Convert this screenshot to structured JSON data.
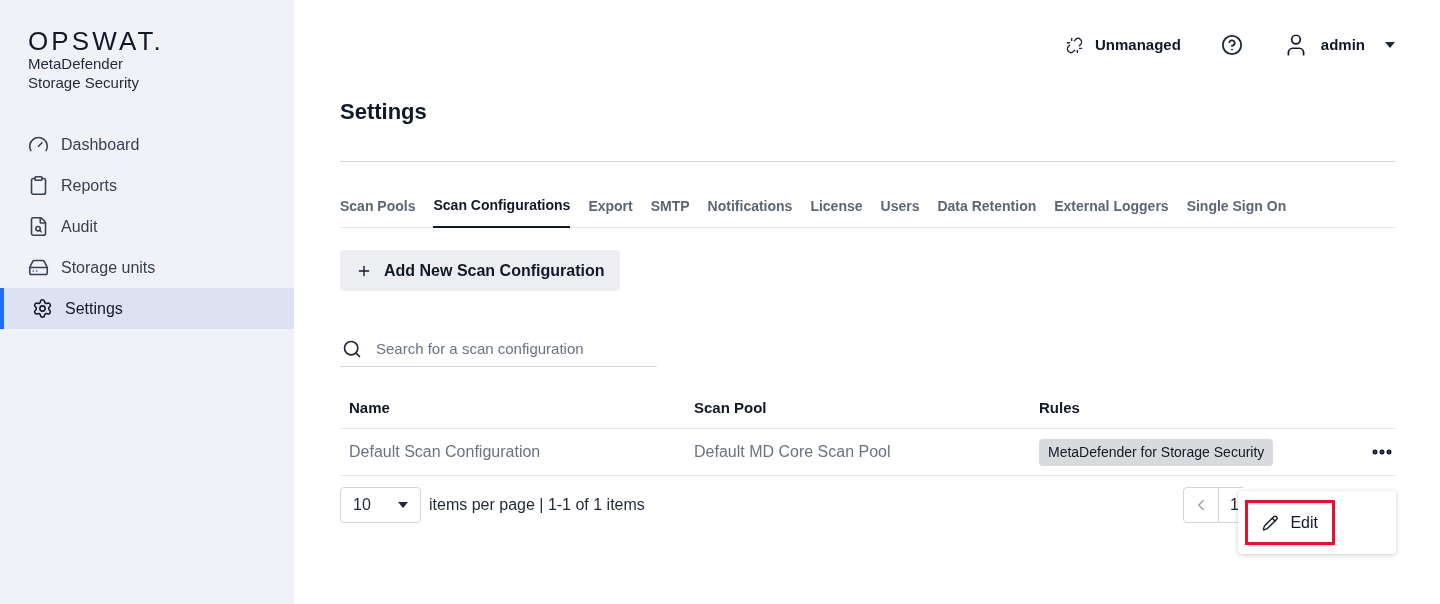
{
  "brand": {
    "logo": "OPSWAT.",
    "product": [
      "MetaDefender",
      "Storage Security"
    ]
  },
  "sidebar": {
    "items": [
      {
        "label": "Dashboard",
        "selected": false
      },
      {
        "label": "Reports",
        "selected": false
      },
      {
        "label": "Audit",
        "selected": false
      },
      {
        "label": "Storage units",
        "selected": false
      },
      {
        "label": "Settings",
        "selected": true
      }
    ]
  },
  "header": {
    "status": "Unmanaged",
    "user": "admin"
  },
  "page_title": "Settings",
  "tabs": [
    {
      "label": "Scan Pools",
      "selected": false
    },
    {
      "label": "Scan Configurations",
      "selected": true
    },
    {
      "label": "Export",
      "selected": false
    },
    {
      "label": "SMTP",
      "selected": false
    },
    {
      "label": "Notifications",
      "selected": false
    },
    {
      "label": "License",
      "selected": false
    },
    {
      "label": "Users",
      "selected": false
    },
    {
      "label": "Data Retention",
      "selected": false
    },
    {
      "label": "External Loggers",
      "selected": false
    },
    {
      "label": "Single Sign On",
      "selected": false
    }
  ],
  "add_button": "Add New Scan Configuration",
  "search": {
    "placeholder": "Search for a scan configuration"
  },
  "table": {
    "columns": [
      "Name",
      "Scan Pool",
      "Rules"
    ],
    "rows": [
      {
        "name": "Default Scan Configuration",
        "scan_pool": "Default MD Core Scan Pool",
        "rules": [
          "MetaDefender for Storage Security"
        ]
      }
    ]
  },
  "pagination": {
    "page_size": "10",
    "summary": "items per page | 1-1 of 1 items",
    "page": "1"
  },
  "row_menu": {
    "items": [
      {
        "label": "Edit",
        "highlighted": true
      }
    ]
  }
}
